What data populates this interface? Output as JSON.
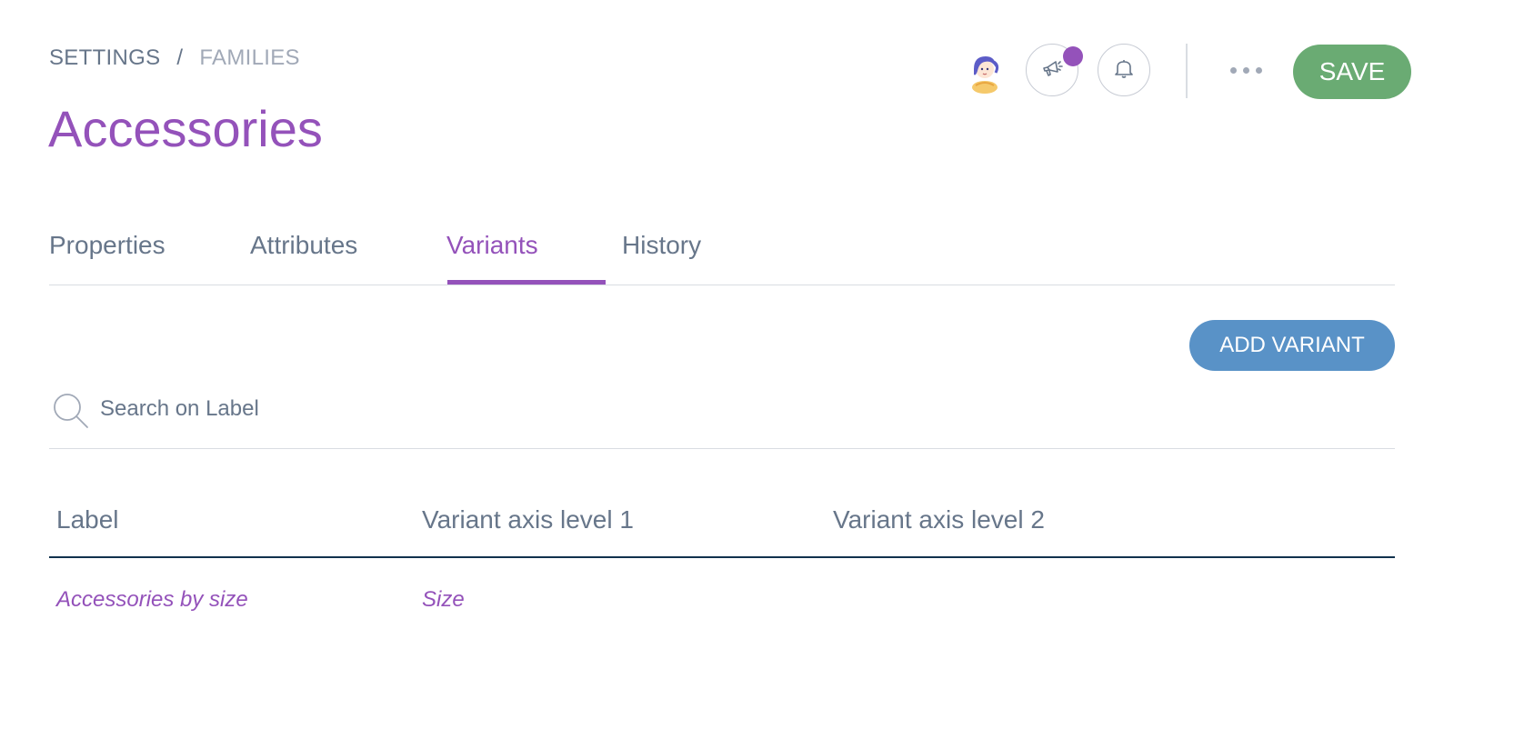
{
  "breadcrumb": {
    "settings": "SETTINGS",
    "separator": "/",
    "families": "FAMILIES"
  },
  "page": {
    "title": "Accessories"
  },
  "header": {
    "avatar_icon": "user-avatar-illustration",
    "announcement_icon": "megaphone-icon",
    "notification_icon": "bell-icon",
    "more_icon": "more-horizontal-icon",
    "save_label": "SAVE"
  },
  "tabs": [
    {
      "label": "Properties",
      "active": false
    },
    {
      "label": "Attributes",
      "active": false
    },
    {
      "label": "Variants",
      "active": true
    },
    {
      "label": "History",
      "active": false
    }
  ],
  "actions": {
    "add_variant_label": "ADD VARIANT"
  },
  "search": {
    "placeholder": "Search on Label",
    "value": "",
    "icon": "search-icon"
  },
  "table": {
    "columns": [
      "Label",
      "Variant axis level 1",
      "Variant axis level 2"
    ],
    "rows": [
      {
        "label": "Accessories by size",
        "axis1": "Size",
        "axis2": ""
      }
    ]
  },
  "colors": {
    "accent_purple": "#9452ba",
    "save_green": "#6aab73",
    "add_blue": "#5992c7",
    "text_grey": "#67768a",
    "border": "#d9dde2",
    "table_header_border": "#11324d"
  }
}
